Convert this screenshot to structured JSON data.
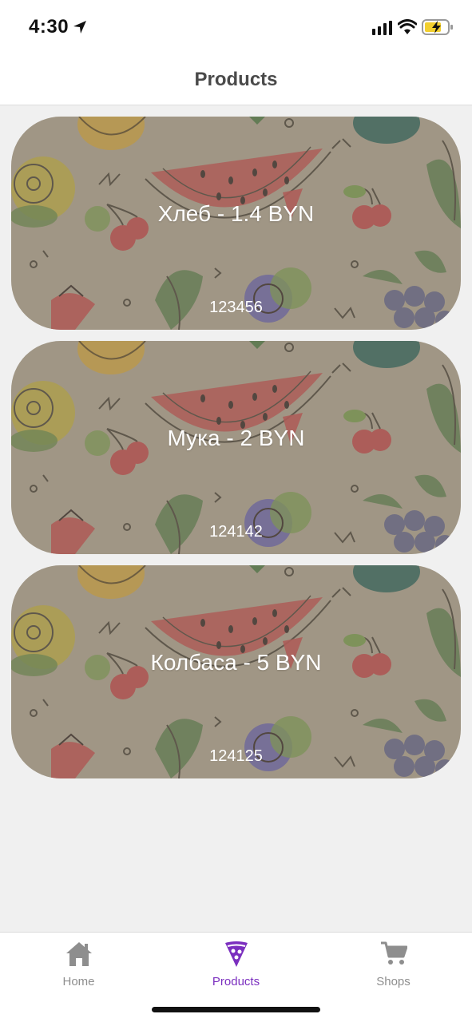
{
  "status_bar": {
    "time": "4:30"
  },
  "header": {
    "title": "Products"
  },
  "products": [
    {
      "title": "Хлеб - 1.4 BYN",
      "code": "123456"
    },
    {
      "title": "Мука - 2 BYN",
      "code": "124142"
    },
    {
      "title": "Колбаса - 5 BYN",
      "code": "124125"
    }
  ],
  "tabs": [
    {
      "label": "Home",
      "icon": "home-icon",
      "active": false
    },
    {
      "label": "Products",
      "icon": "pizza-icon",
      "active": true
    },
    {
      "label": "Shops",
      "icon": "cart-icon",
      "active": false
    }
  ],
  "colors": {
    "active_tab": "#7b2fbf",
    "inactive_tab": "#8e8e8e",
    "card_bg": "#a99f8e",
    "background": "#f0f0f0"
  }
}
